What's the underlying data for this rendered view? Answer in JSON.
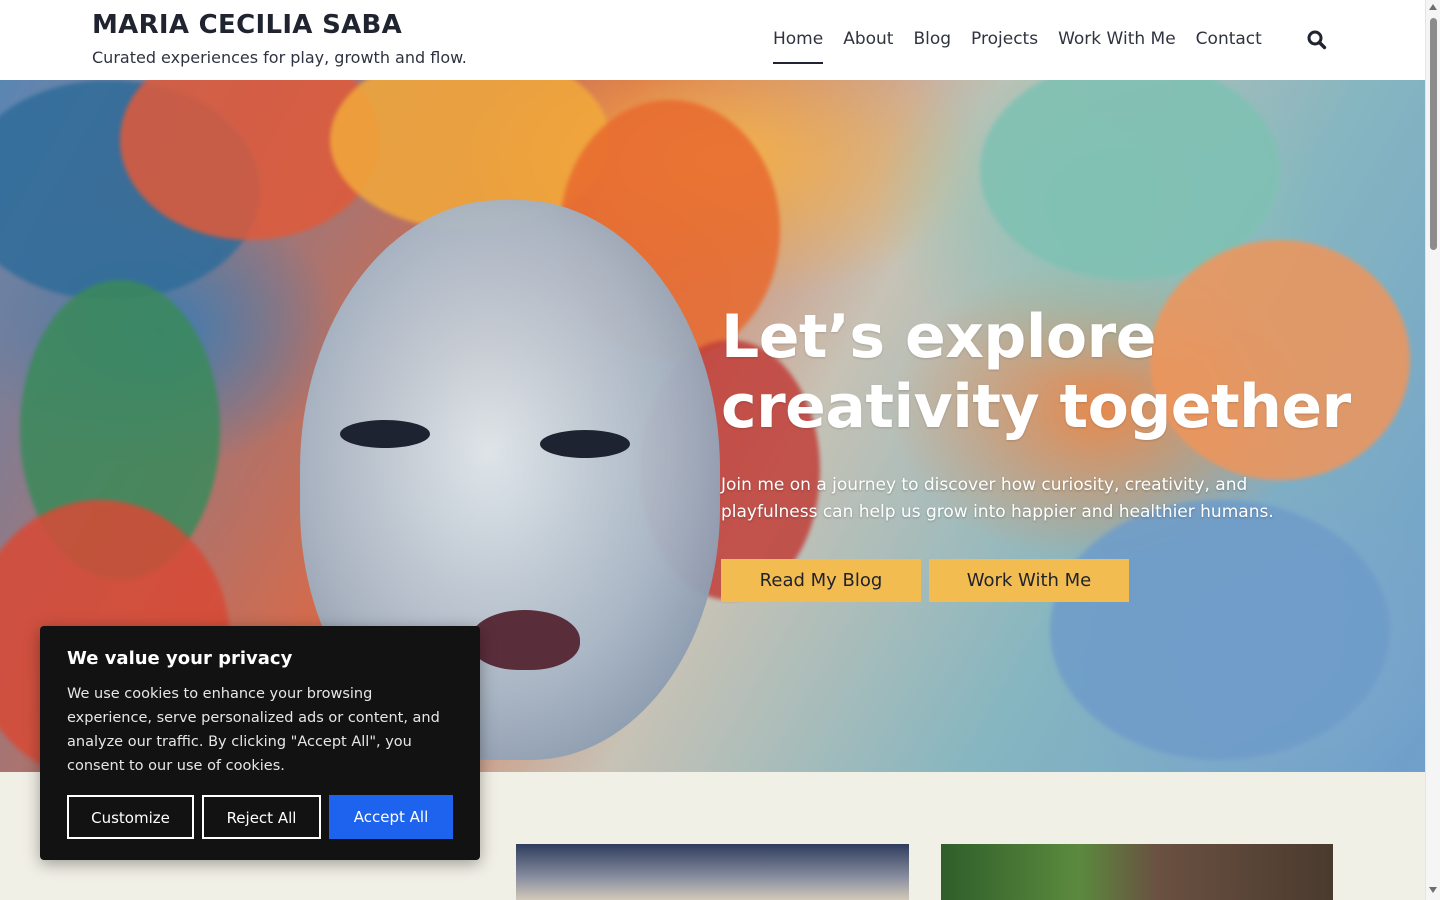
{
  "site": {
    "title": "MARIA CECILIA SABA",
    "tagline": "Curated experiences for play, growth and flow."
  },
  "nav": {
    "items": [
      {
        "label": "Home",
        "active": true
      },
      {
        "label": "About"
      },
      {
        "label": "Blog"
      },
      {
        "label": "Projects"
      },
      {
        "label": "Work With Me"
      },
      {
        "label": "Contact"
      }
    ],
    "search_icon": "search-icon"
  },
  "hero": {
    "title_line1": "Let’s explore",
    "title_line2": "creativity together",
    "subtitle": "Join me on a journey to discover how curiosity, creativity, and playfulness can help us grow into happier and healthier humans.",
    "buttons": [
      "Read My Blog",
      "Work With Me"
    ],
    "button_color": "#f2bc51"
  },
  "cookie_banner": {
    "title": "We value your privacy",
    "text": "We use cookies to enhance your browsing experience, serve personalized ads or content, and analyze our traffic. By clicking \"Accept All\", you consent to our use of cookies.",
    "customize_label": "Customize",
    "reject_label": "Reject All",
    "accept_label": "Accept All",
    "accept_color": "#1d63ed"
  },
  "colors": {
    "page_background": "#f1f0e6",
    "header_background": "#ffffff",
    "text_dark": "#1f2430"
  }
}
